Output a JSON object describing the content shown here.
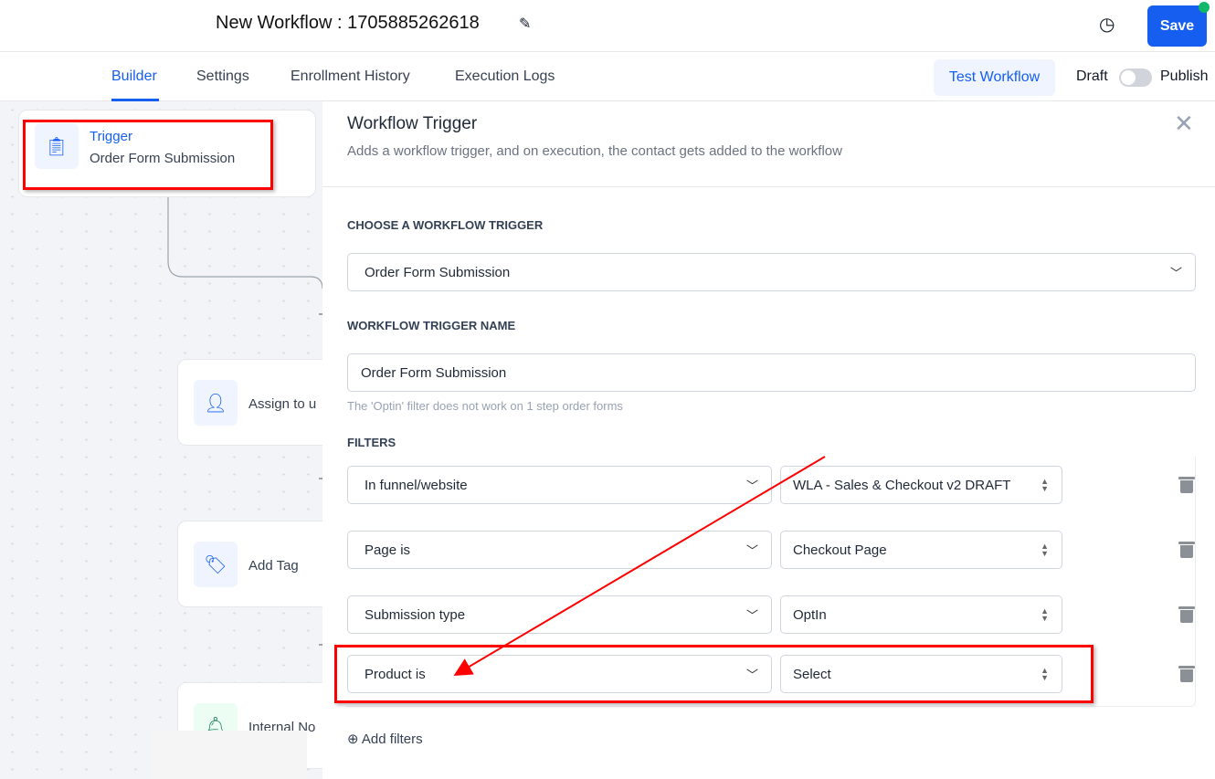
{
  "header": {
    "title": "New Workflow : 1705885262618",
    "edit_icon": "pencil-icon",
    "history_icon": "history-icon",
    "save_label": "Save",
    "status_dot_color": "#12b76a"
  },
  "tabs": [
    {
      "label": "Builder",
      "active": true
    },
    {
      "label": "Settings"
    },
    {
      "label": "Enrollment History"
    },
    {
      "label": "Execution Logs"
    }
  ],
  "actions": {
    "test_label": "Test Workflow",
    "draft_label": "Draft",
    "publish_label": "Publish",
    "published": false
  },
  "canvas": {
    "nodes": [
      {
        "title": "Trigger",
        "subtitle": "Order Form Submission",
        "icon": "clipboard-icon"
      },
      {
        "label": "Assign to u",
        "icon": "user-check-icon"
      },
      {
        "label": "Add Tag",
        "icon": "tag-icon"
      },
      {
        "label": "Internal No",
        "icon": "bell-icon"
      }
    ]
  },
  "panel": {
    "title": "Workflow Trigger",
    "subtitle": "Adds a workflow trigger, and on execution, the contact gets added to the workflow",
    "trigger_label": "CHOOSE A WORKFLOW TRIGGER",
    "trigger_value": "Order Form Submission",
    "name_label": "WORKFLOW TRIGGER NAME",
    "name_value": "Order Form Submission",
    "hint": "The 'Optin' filter does not work on 1 step order forms",
    "filters_label": "FILTERS",
    "filters": [
      {
        "field": "In funnel/website",
        "value": "WLA - Sales & Checkout v2 DRAFT"
      },
      {
        "field": "Page is",
        "value": "Checkout Page"
      },
      {
        "field": "Submission type",
        "value": "OptIn"
      },
      {
        "field": "Product is",
        "value": "Select"
      }
    ],
    "add_filters": "Add filters"
  },
  "accent": "#155eef"
}
